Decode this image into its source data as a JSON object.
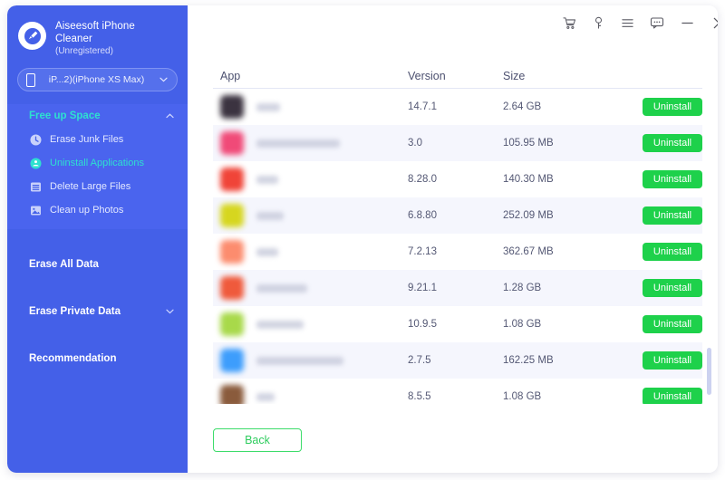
{
  "app": {
    "brand_line1": "Aiseesoft iPhone",
    "brand_line2": "Cleaner",
    "brand_status": "(Unregistered)",
    "logo_icon": "broom-cleaner-icon"
  },
  "device": {
    "label": "iP...2)(iPhone XS Max)",
    "phone_icon": "iphone-icon",
    "chevron_icon": "chevron-down-icon"
  },
  "sidebar": {
    "groups": [
      {
        "label": "Free up Space",
        "active": true,
        "expanded": true,
        "chevron_icon": "chevron-up-icon",
        "items": [
          {
            "label": "Erase Junk Files",
            "icon": "clock-icon",
            "active": false
          },
          {
            "label": "Uninstall Applications",
            "icon": "apps-icon",
            "active": true
          },
          {
            "label": "Delete Large Files",
            "icon": "list-icon",
            "active": false
          },
          {
            "label": "Clean up Photos",
            "icon": "photo-icon",
            "active": false
          }
        ]
      },
      {
        "label": "Erase All Data",
        "active": false,
        "expanded": false,
        "chevron_icon": ""
      },
      {
        "label": "Erase Private Data",
        "active": false,
        "expanded": false,
        "chevron_icon": "chevron-down-icon"
      },
      {
        "label": "Recommendation",
        "active": false,
        "expanded": false,
        "chevron_icon": ""
      }
    ]
  },
  "titlebar": {
    "buttons": [
      {
        "name": "cart-icon",
        "title": "Buy"
      },
      {
        "name": "key-icon",
        "title": "Register"
      },
      {
        "name": "menu-icon",
        "title": "Menu"
      },
      {
        "name": "feedback-icon",
        "title": "Feedback"
      },
      {
        "name": "minimize-icon",
        "title": "Minimize"
      },
      {
        "name": "close-icon",
        "title": "Close"
      }
    ]
  },
  "table": {
    "columns": [
      "App",
      "Version",
      "Size",
      ""
    ],
    "rows": [
      {
        "app_name_redacted": true,
        "name_width": 26,
        "icon_color": "#3b3340",
        "version": "14.7.1",
        "size": "2.64 GB",
        "action": "Uninstall"
      },
      {
        "app_name_redacted": true,
        "name_width": 92,
        "icon_color": "#f04a78",
        "version": "3.0",
        "size": "105.95 MB",
        "action": "Uninstall"
      },
      {
        "app_name_redacted": true,
        "name_width": 24,
        "icon_color": "#f04438",
        "version": "8.28.0",
        "size": "140.30 MB",
        "action": "Uninstall"
      },
      {
        "app_name_redacted": true,
        "name_width": 30,
        "icon_color": "#d6d61f",
        "version": "6.8.80",
        "size": "252.09 MB",
        "action": "Uninstall"
      },
      {
        "app_name_redacted": true,
        "name_width": 24,
        "icon_color": "#fc8c6e",
        "version": "7.2.13",
        "size": "362.67 MB",
        "action": "Uninstall"
      },
      {
        "app_name_redacted": true,
        "name_width": 56,
        "icon_color": "#ef5a3c",
        "version": "9.21.1",
        "size": "1.28 GB",
        "action": "Uninstall"
      },
      {
        "app_name_redacted": true,
        "name_width": 52,
        "icon_color": "#a8d94a",
        "version": "10.9.5",
        "size": "1.08 GB",
        "action": "Uninstall"
      },
      {
        "app_name_redacted": true,
        "name_width": 96,
        "icon_color": "#3d9dfc",
        "version": "2.7.5",
        "size": "162.25 MB",
        "action": "Uninstall"
      },
      {
        "app_name_redacted": true,
        "name_width": 20,
        "icon_color": "#8a5b3c",
        "version": "8.5.5",
        "size": "1.08 GB",
        "action": "Uninstall"
      },
      {
        "app_name_redacted": true,
        "name_width": 22,
        "icon_color": "#f2e813",
        "version": "",
        "size": "",
        "action": ""
      }
    ]
  },
  "footer": {
    "back_label": "Back"
  }
}
